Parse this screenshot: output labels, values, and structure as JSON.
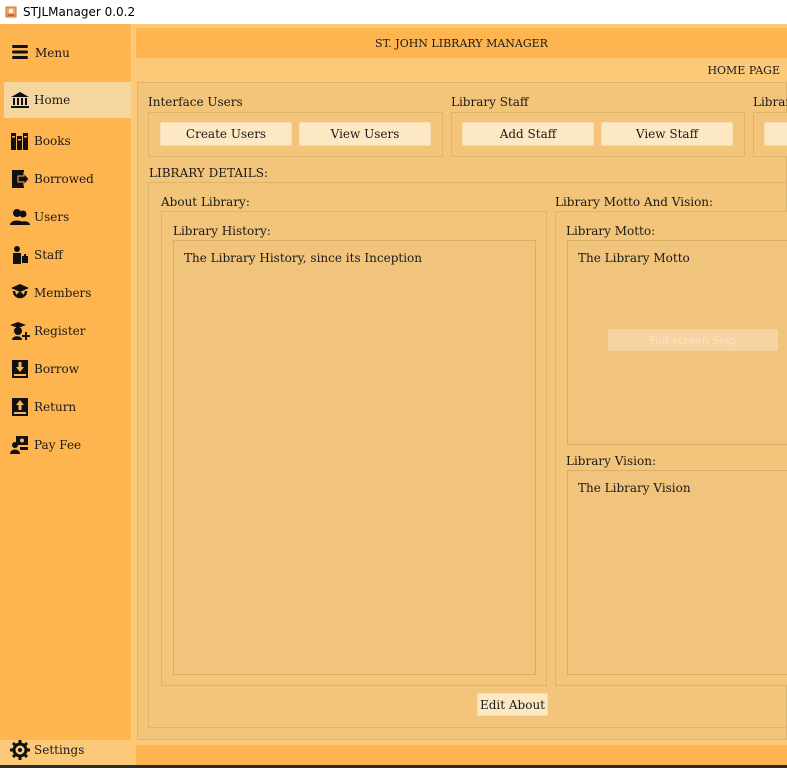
{
  "window": {
    "title": "STJLManager 0.0.2"
  },
  "sidebar": {
    "menu_label": "Menu",
    "items": [
      {
        "label": "Home",
        "icon": "bank-icon"
      },
      {
        "label": "Books",
        "icon": "books-icon"
      },
      {
        "label": "Borrowed",
        "icon": "borrowed-icon"
      },
      {
        "label": "Users",
        "icon": "users-icon"
      },
      {
        "label": "Staff",
        "icon": "staff-icon"
      },
      {
        "label": "Members",
        "icon": "graduate-icon"
      },
      {
        "label": "Register",
        "icon": "register-icon"
      },
      {
        "label": "Borrow",
        "icon": "borrow-book-icon"
      },
      {
        "label": "Return",
        "icon": "return-book-icon"
      },
      {
        "label": "Pay Fee",
        "icon": "pay-fee-icon"
      }
    ],
    "settings_label": "Settings"
  },
  "header": {
    "title": "ST. JOHN LIBRARY MANAGER",
    "page_label": "HOME PAGE"
  },
  "groups": {
    "interface_users": {
      "title": "Interface Users",
      "create_label": "Create Users",
      "view_label": "View Users"
    },
    "library_staff": {
      "title": "Library Staff",
      "add_label": "Add Staff",
      "view_label": "View Staff"
    },
    "library_cut": {
      "title": "Library"
    }
  },
  "details": {
    "title": "LIBRARY DETAILS:",
    "about": {
      "title": "About Library:",
      "history_title": "Library History:",
      "history_text": "The Library History, since its Inception"
    },
    "motto_vision": {
      "title": "Library Motto And Vision:",
      "motto_title": "Library Motto:",
      "motto_text": "The Library Motto",
      "vision_title": "Library Vision:",
      "vision_text": "The Library Vision"
    },
    "edit_label": "Edit About"
  },
  "overlay": {
    "snip_text": "Full-screen Snip"
  }
}
